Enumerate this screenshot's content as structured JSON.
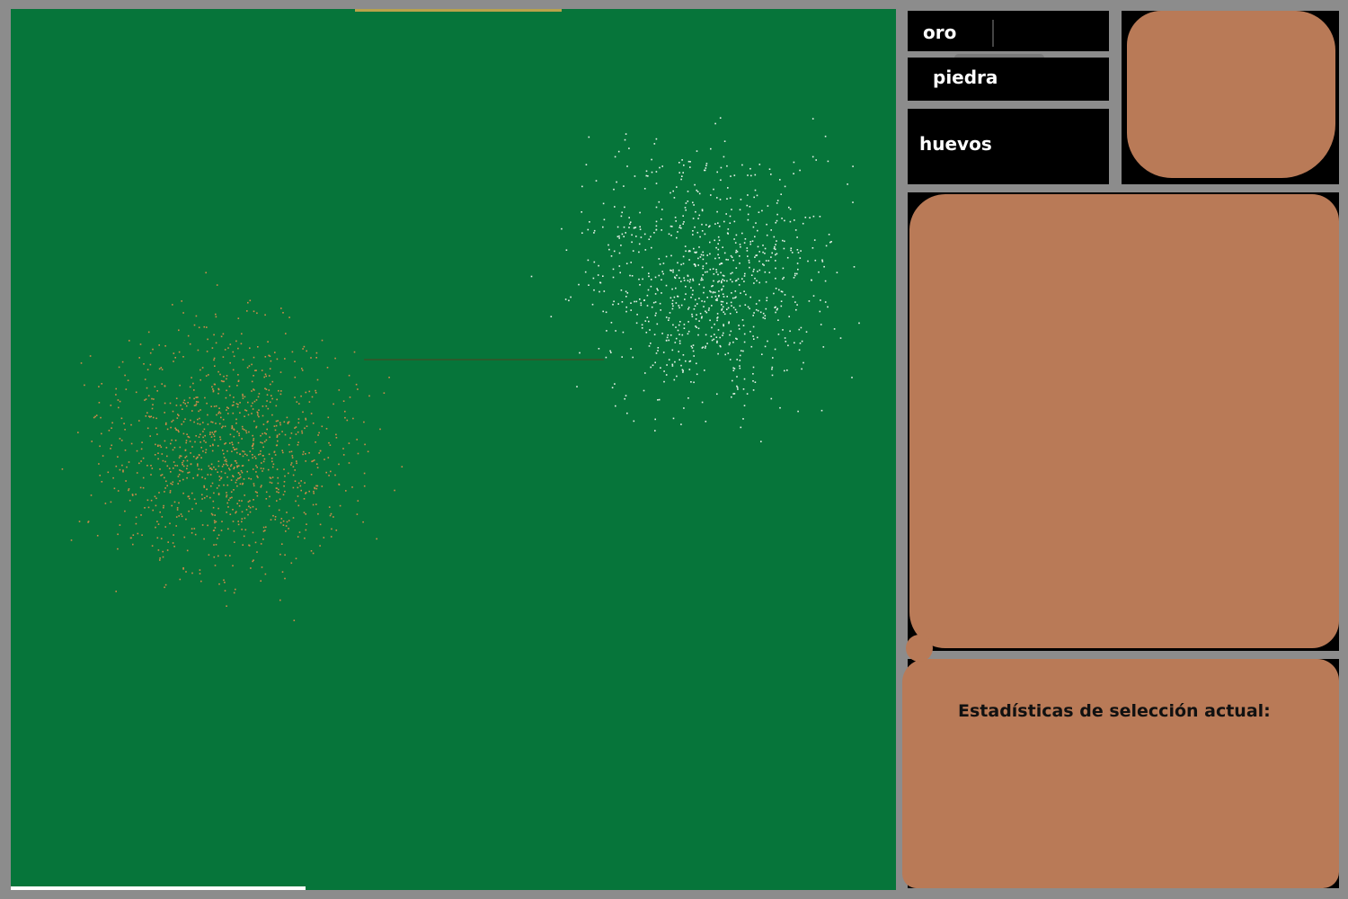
{
  "resources": {
    "gold_label": "oro",
    "stone_label": "piedra",
    "eggs_label": "huevos"
  },
  "stats": {
    "title": "Estadísticas de selección actual:"
  },
  "colors": {
    "grass": "#06753a",
    "panel_bg": "#000000",
    "frame": "#8c8c8c",
    "paint_blob": "#b97a57",
    "resource_text": "#ffffff"
  },
  "map": {
    "clusters": [
      {
        "name": "orange-speckle-cluster",
        "color": "#d08a4a"
      },
      {
        "name": "white-speckle-cluster",
        "color": "#e8f2e8"
      }
    ]
  }
}
